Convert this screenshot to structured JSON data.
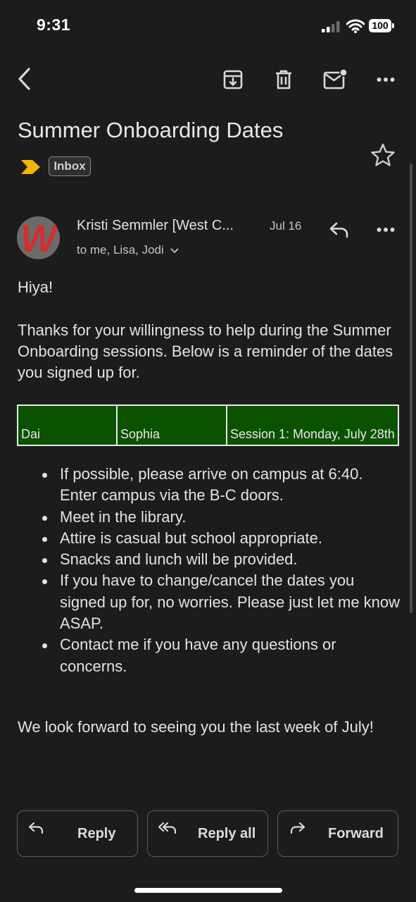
{
  "status_bar": {
    "time": "9:31",
    "battery": "100"
  },
  "toolbar": {
    "back_icon": "chevron-left-icon",
    "archive_icon": "archive-icon",
    "delete_icon": "trash-icon",
    "mark_unread_icon": "mail-unread-icon",
    "more_icon": "more-horizontal-icon"
  },
  "email": {
    "subject": "Summer Onboarding Dates",
    "label": "Inbox",
    "importance_color": "#f5b400",
    "sender": "Kristi Semmler [West C...",
    "date": "Jul 16",
    "recipients": "to me, Lisa, Jodi",
    "avatar_letter": "W",
    "avatar_color": "#d32f2f",
    "greeting": "Hiya!",
    "intro": "Thanks for your willingness to help during the Summer Onboarding sessions. Below is a reminder of the dates you signed up for.",
    "schedule": [
      {
        "name1": "Dai",
        "name2": "Sophia",
        "session": "Session 1: Monday, July 28th"
      }
    ],
    "bullets": [
      "If possible, please arrive on campus at 6:40. Enter campus via the B-C doors.",
      "Meet in the library.",
      "Attire is casual but school appropriate.",
      "Snacks and lunch will be provided.",
      "If you have to change/cancel the dates you signed up for, no worries. Please just let me know ASAP.",
      "Contact me if you have any questions or concerns."
    ],
    "closing": "We look forward to seeing you the last week of July!"
  },
  "actions": {
    "reply": "Reply",
    "reply_all": "Reply all",
    "forward": "Forward"
  },
  "colors": {
    "background": "#1c1c1e",
    "table_bg": "#0a5200"
  }
}
